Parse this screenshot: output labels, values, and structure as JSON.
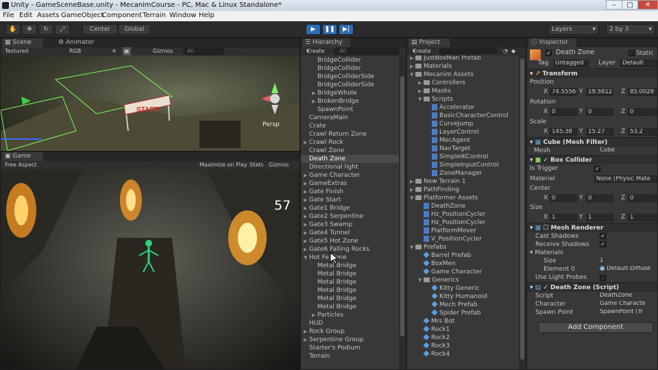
{
  "window": {
    "title": "Unity - GameSceneBase.unity - MecanimCourse - PC, Mac & Linux Standalone*"
  },
  "menu": [
    "File",
    "Edit",
    "Assets",
    "GameObject",
    "Component",
    "Terrain",
    "Window",
    "Help"
  ],
  "toolbar": {
    "center": "Center",
    "global": "Global",
    "layers": "Layers",
    "layout": "2 by 3"
  },
  "scene": {
    "tab": "Scene",
    "tab2": "Animator",
    "shading": "Textured",
    "color": "RGB",
    "gizmos": "Gizmos",
    "search": "All",
    "persp": "Persp",
    "start_sign": "START"
  },
  "game": {
    "tab": "Game",
    "aspect": "Free Aspect",
    "maximize": "Maximize on Play",
    "stats": "Stats",
    "gizmos": "Gizmos",
    "counter": "57"
  },
  "hierarchy": {
    "tab": "Hierarchy",
    "create": "Create",
    "search": "All",
    "items": [
      {
        "label": "BridgeCollider",
        "indent": 2,
        "arrow": false
      },
      {
        "label": "BridgeCollider",
        "indent": 2,
        "arrow": false
      },
      {
        "label": "BridgeColliderSide",
        "indent": 2,
        "arrow": false
      },
      {
        "label": "BridgeColliderSide",
        "indent": 2,
        "arrow": false
      },
      {
        "label": "BridgeWhole",
        "indent": 2,
        "arrow": true
      },
      {
        "label": "BrokenBridge",
        "indent": 2,
        "arrow": true
      },
      {
        "label": "SpawnPoint",
        "indent": 2,
        "arrow": false
      },
      {
        "label": "CameraMain",
        "indent": 1,
        "arrow": false
      },
      {
        "label": "Crate",
        "indent": 1,
        "arrow": false
      },
      {
        "label": "Crawl Return Zone",
        "indent": 1,
        "arrow": false
      },
      {
        "label": "Crawl Rock",
        "indent": 1,
        "arrow": true
      },
      {
        "label": "Crawl Zone",
        "indent": 1,
        "arrow": false
      },
      {
        "label": "Death Zone",
        "indent": 1,
        "arrow": false,
        "selected": true
      },
      {
        "label": "Directional light",
        "indent": 1,
        "arrow": false
      },
      {
        "label": "Game Character",
        "indent": 1,
        "arrow": true
      },
      {
        "label": "GameExtras",
        "indent": 1,
        "arrow": true
      },
      {
        "label": "Gate Finish",
        "indent": 1,
        "arrow": true
      },
      {
        "label": "Gate Start",
        "indent": 1,
        "arrow": true
      },
      {
        "label": "Gate1 Bridge",
        "indent": 1,
        "arrow": true
      },
      {
        "label": "Gate2 Serpentine",
        "indent": 1,
        "arrow": true
      },
      {
        "label": "Gate3 Swamp",
        "indent": 1,
        "arrow": true
      },
      {
        "label": "Gate4 Tunnel",
        "indent": 1,
        "arrow": true
      },
      {
        "label": "Gate5 Hot Zone",
        "indent": 1,
        "arrow": true
      },
      {
        "label": "Gate6 Falling Rocks",
        "indent": 1,
        "arrow": true
      },
      {
        "label": "Hot Fe   Zone",
        "indent": 1,
        "arrow": true,
        "open": true
      },
      {
        "label": "Metal Bridge",
        "indent": 2,
        "arrow": false
      },
      {
        "label": "Metal Bridge",
        "indent": 2,
        "arrow": false
      },
      {
        "label": "Metal Bridge",
        "indent": 2,
        "arrow": false
      },
      {
        "label": "Metal Bridge",
        "indent": 2,
        "arrow": false
      },
      {
        "label": "Metal Bridge",
        "indent": 2,
        "arrow": false
      },
      {
        "label": "Metal Bridge",
        "indent": 2,
        "arrow": false
      },
      {
        "label": "Particles",
        "indent": 2,
        "arrow": true
      },
      {
        "label": "HUD",
        "indent": 1,
        "arrow": false
      },
      {
        "label": "Rock Group",
        "indent": 1,
        "arrow": true
      },
      {
        "label": "Serpentine Group",
        "indent": 1,
        "arrow": true
      },
      {
        "label": "Starter's Podium",
        "indent": 1,
        "arrow": false
      },
      {
        "label": "Terrain",
        "indent": 1,
        "arrow": false
      }
    ]
  },
  "project": {
    "tab": "Project",
    "create": "Create",
    "items": [
      {
        "label": "JustBoxMan Prefab",
        "indent": 1,
        "kind": "folder",
        "open": false
      },
      {
        "label": "Materials",
        "indent": 1,
        "kind": "folder",
        "open": false
      },
      {
        "label": "Mecanim Assets",
        "indent": 1,
        "kind": "folder",
        "open": true
      },
      {
        "label": "Controllers",
        "indent": 2,
        "kind": "folder",
        "open": false
      },
      {
        "label": "Masks",
        "indent": 2,
        "kind": "folder",
        "open": false
      },
      {
        "label": "Scripts",
        "indent": 2,
        "kind": "folder",
        "open": true
      },
      {
        "label": "Accelerator",
        "indent": 3,
        "kind": "script"
      },
      {
        "label": "BasicCharacterControl",
        "indent": 3,
        "kind": "script"
      },
      {
        "label": "CurveJump",
        "indent": 3,
        "kind": "script"
      },
      {
        "label": "LayerControl",
        "indent": 3,
        "kind": "script"
      },
      {
        "label": "MecAgent",
        "indent": 3,
        "kind": "script"
      },
      {
        "label": "NavTarget",
        "indent": 3,
        "kind": "script"
      },
      {
        "label": "SimpleIKControl",
        "indent": 3,
        "kind": "script"
      },
      {
        "label": "SimpleInputControl",
        "indent": 3,
        "kind": "script"
      },
      {
        "label": "ZoneManager",
        "indent": 3,
        "kind": "script"
      },
      {
        "label": "New Terrain 1",
        "indent": 1,
        "kind": "folder",
        "open": false
      },
      {
        "label": "PathFinding",
        "indent": 1,
        "kind": "folder",
        "open": false
      },
      {
        "label": "Platformer Assets",
        "indent": 1,
        "kind": "folder",
        "open": true
      },
      {
        "label": "DeathZone",
        "indent": 2,
        "kind": "script"
      },
      {
        "label": "Hz_PositionCycler",
        "indent": 2,
        "kind": "script"
      },
      {
        "label": "Hz_PositionCycler",
        "indent": 2,
        "kind": "script"
      },
      {
        "label": "PlatformMover",
        "indent": 2,
        "kind": "script"
      },
      {
        "label": "V_PositionCycler",
        "indent": 2,
        "kind": "script"
      },
      {
        "label": "Prefabs",
        "indent": 1,
        "kind": "folder",
        "open": true
      },
      {
        "label": "Barrel Prefab",
        "indent": 2,
        "kind": "prefab"
      },
      {
        "label": "BoxMen",
        "indent": 2,
        "kind": "prefab"
      },
      {
        "label": "Game Character",
        "indent": 2,
        "kind": "prefab"
      },
      {
        "label": "Generics",
        "indent": 2,
        "kind": "folder",
        "open": true
      },
      {
        "label": "Kitty Generic",
        "indent": 3,
        "kind": "prefab"
      },
      {
        "label": "Kitty Humanoid",
        "indent": 3,
        "kind": "prefab"
      },
      {
        "label": "Mech Prefab",
        "indent": 3,
        "kind": "prefab"
      },
      {
        "label": "Spider Prefab",
        "indent": 3,
        "kind": "prefab"
      },
      {
        "label": "Mrs Bot",
        "indent": 2,
        "kind": "prefab"
      },
      {
        "label": "Rock1",
        "indent": 2,
        "kind": "prefab"
      },
      {
        "label": "Rock2",
        "indent": 2,
        "kind": "prefab"
      },
      {
        "label": "Rock3",
        "indent": 2,
        "kind": "prefab"
      },
      {
        "label": "Rock4",
        "indent": 2,
        "kind": "prefab"
      }
    ]
  },
  "inspector": {
    "tab": "Inspector",
    "name": "Death Zone",
    "static": "Static",
    "tag_label": "Tag",
    "tag": "Untagged",
    "layer_label": "Layer",
    "layer": "Default",
    "transform": {
      "title": "Transform",
      "position": "Position",
      "rotation": "Rotation",
      "scale": "Scale",
      "pos": [
        "74.55566",
        "19.5812",
        "85.0028"
      ],
      "rot": [
        "0",
        "0",
        "0"
      ],
      "scl": [
        "145.38",
        "15.27",
        "53.2"
      ]
    },
    "meshfilter": {
      "title": "Cube (Mesh Filter)",
      "mesh_label": "Mesh",
      "mesh": "Cube"
    },
    "boxcollider": {
      "title": "Box Collider",
      "trigger": "Is Trigger",
      "material_label": "Material",
      "material": "None (Physic Mate",
      "center": "Center",
      "center_v": [
        "0",
        "0",
        "0"
      ],
      "size": "Size",
      "size_v": [
        "1",
        "1",
        "1"
      ]
    },
    "meshrenderer": {
      "title": "Mesh Renderer",
      "cast": "Cast Shadows",
      "receive": "Receive Shadows",
      "materials": "Materials",
      "size_label": "Size",
      "size_value": "1",
      "element": "Element 0",
      "element_value": "Default-Diffuse",
      "lightprobes": "Use Light Probes"
    },
    "script": {
      "title": "Death Zone (Script)",
      "script_label": "Script",
      "script": "DeathZone",
      "char_label": "Character",
      "char": "Game Characte",
      "spawn_label": "Spawn Point",
      "spawn": "SpawnPoint (Tr"
    },
    "add_component": "Add Component"
  }
}
